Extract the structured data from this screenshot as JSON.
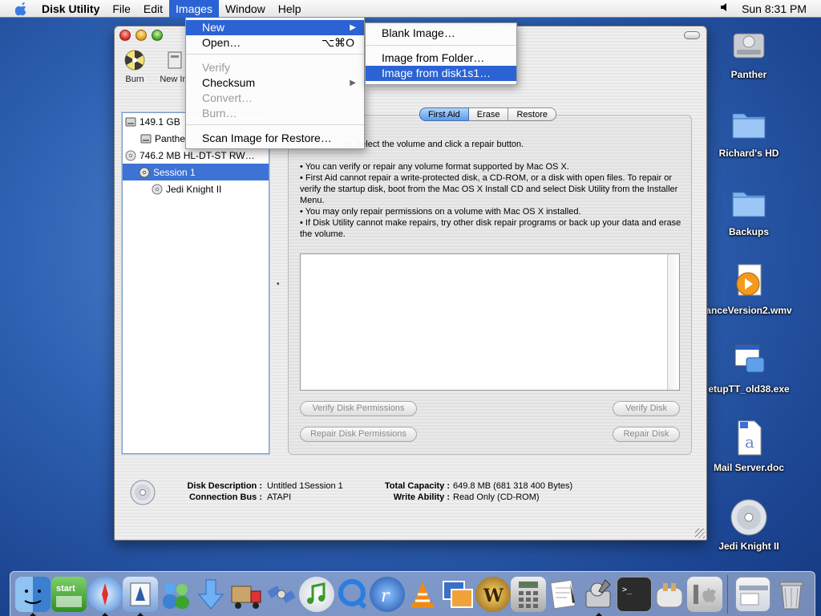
{
  "menubar": {
    "app_name": "Disk Utility",
    "items": [
      "File",
      "Edit",
      "Images",
      "Window",
      "Help"
    ],
    "active_item": "Images",
    "clock": "Sun 8:31 PM"
  },
  "images_menu": {
    "items": [
      {
        "label": "New",
        "state": "highlighted",
        "submenu": true
      },
      {
        "label": "Open…",
        "shortcut": "⌥⌘O"
      },
      {
        "label": "Verify",
        "state": "disabled"
      },
      {
        "label": "Checksum",
        "submenu": true
      },
      {
        "label": "Convert…",
        "state": "disabled"
      },
      {
        "label": "Burn…",
        "state": "disabled"
      },
      {
        "label": "Scan Image for Restore…"
      }
    ]
  },
  "new_submenu": {
    "items": [
      {
        "label": "Blank Image…"
      },
      {
        "label": "Image from Folder…"
      },
      {
        "label": "Image from disk1s1…",
        "state": "highlighted"
      }
    ]
  },
  "toolbar": {
    "burn_label": "Burn",
    "new_image_label": "New Im"
  },
  "sidebar": {
    "items": [
      {
        "label": "149.1 GB",
        "level": 0
      },
      {
        "label": "Panthe",
        "level": 1
      },
      {
        "label": "746.2 MB HL-DT-ST RW…",
        "level": 0
      },
      {
        "label": "Session 1",
        "level": 1,
        "selected": true
      },
      {
        "label": "Jedi Knight II",
        "level": 2
      }
    ]
  },
  "tabs": [
    "First Aid",
    "Erase",
    "Restore"
  ],
  "active_tab": "First Aid",
  "first_aid": {
    "intro": "id, select the volume and click a repair button.",
    "bullets": [
      "• You can verify or repair any volume format supported by Mac OS X.",
      "• First Aid cannot repair a write-protected disk, a CD-ROM, or a disk with open files. To repair or verify the startup disk, boot from the Mac OS X Install CD and select Disk Utility from the Installer Menu.",
      "• You may only repair permissions on a volume with Mac OS X installed.",
      "• If Disk Utility cannot make repairs, try other disk repair programs or back up your data and erase the volume."
    ],
    "buttons": {
      "verify_permissions": "Verify Disk Permissions",
      "verify_disk": "Verify Disk",
      "repair_permissions": "Repair Disk Permissions",
      "repair_disk": "Repair Disk"
    }
  },
  "disk_info": {
    "description_label": "Disk Description :",
    "description_value": "Untitled 1Session 1",
    "bus_label": "Connection Bus :",
    "bus_value": "ATAPI",
    "capacity_label": "Total Capacity :",
    "capacity_value": "649.8 MB (681 318 400 Bytes)",
    "write_label": "Write Ability :",
    "write_value": "Read Only (CD-ROM)"
  },
  "desktop_icons": [
    {
      "label": "Panther",
      "icon": "hard-drive-icon"
    },
    {
      "label": "Richard's HD",
      "icon": "folder-icon"
    },
    {
      "label": "Backups",
      "icon": "folder-icon"
    },
    {
      "label": "anceVersion2.wmv",
      "icon": "media-file-icon"
    },
    {
      "label": "etupTT_old38.exe",
      "icon": "exe-file-icon"
    },
    {
      "label": "Mail Server.doc",
      "icon": "document-icon"
    },
    {
      "label": "Jedi Knight II",
      "icon": "cd-icon"
    }
  ],
  "dock": {
    "items": [
      "finder-icon",
      "start-icon",
      "safari-icon",
      "mail-icon",
      "ichat-icon",
      "downloads-icon",
      "delivery-icon",
      "satellite-icon",
      "itunes-icon",
      "quicktime-icon",
      "realplayer-icon",
      "vlc-icon",
      "iphoto-icon",
      "warcraft-icon",
      "calculator-icon",
      "textedit-icon",
      "disk-utility-icon",
      "terminal-icon",
      "toaster-icon",
      "system-prefs-icon",
      "window-minimized-icon",
      "trash-icon"
    ]
  },
  "colors": {
    "selection": "#3c73d4",
    "menu_highlight": "#2b63d4",
    "desktop": "#2f62b3"
  }
}
